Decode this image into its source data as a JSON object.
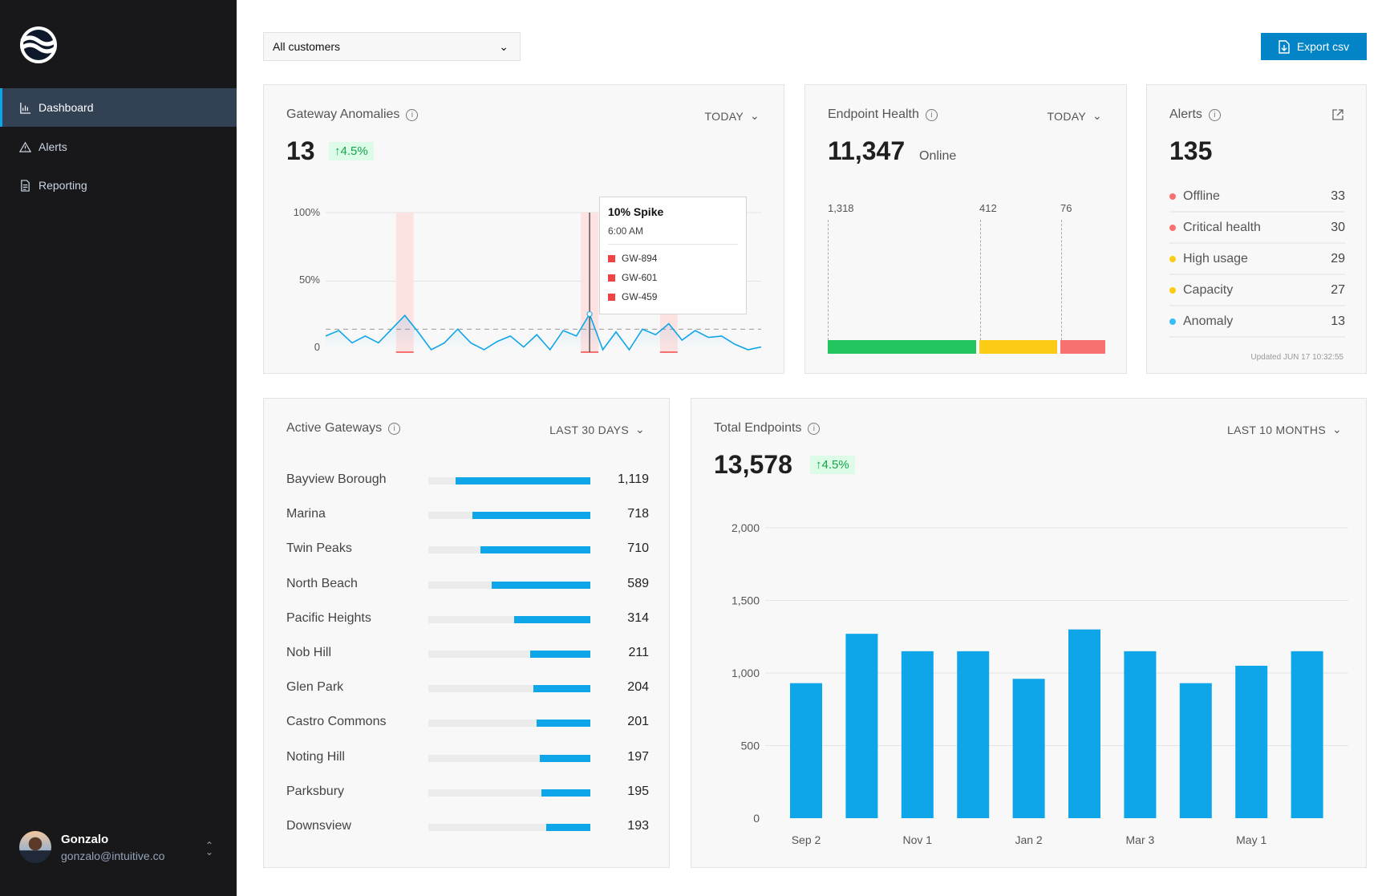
{
  "sidebar": {
    "items": [
      {
        "label": "Dashboard",
        "icon": "bar-chart-icon",
        "active": true
      },
      {
        "label": "Alerts",
        "icon": "warning-icon"
      },
      {
        "label": "Reporting",
        "icon": "document-icon"
      }
    ],
    "user": {
      "name": "Gonzalo",
      "email": "gonzalo@intuitive.co"
    }
  },
  "toolbar": {
    "customer_select": "All customers",
    "export_label": "Export csv"
  },
  "gateway_anomalies": {
    "title": "Gateway Anomalies",
    "range": "TODAY",
    "value": "13",
    "delta": "4.5%",
    "y_ticks": [
      "100%",
      "50%",
      "0"
    ],
    "series_pct": [
      10,
      14,
      5,
      10,
      5,
      15,
      25,
      13,
      0,
      5,
      15,
      5,
      0,
      6,
      10,
      2,
      11,
      0,
      14,
      10,
      26,
      0,
      13,
      0,
      15,
      11,
      19,
      7,
      14,
      9,
      10,
      4,
      0,
      2
    ],
    "threshold_pct": 15,
    "anomaly_indices": [
      6,
      20,
      26
    ],
    "tooltip": {
      "title": "10% Spike",
      "time": "6:00 AM",
      "items": [
        "GW-894",
        "GW-601",
        "GW-459"
      ]
    }
  },
  "endpoint_health": {
    "title": "Endpoint Health",
    "range": "TODAY",
    "value": "11,347",
    "value_label": "Online",
    "segments": [
      {
        "label": "1,318",
        "color": "#22c55e"
      },
      {
        "label": "412",
        "color": "#facc15"
      },
      {
        "label": "76",
        "color": "#f87171"
      }
    ]
  },
  "alerts": {
    "title": "Alerts",
    "value": "135",
    "updated": "Updated JUN 17 10:32:55",
    "items": [
      {
        "label": "Offline",
        "count": "33",
        "color": "#f87171"
      },
      {
        "label": "Critical health",
        "count": "30",
        "color": "#f87171"
      },
      {
        "label": "High usage",
        "count": "29",
        "color": "#facc15"
      },
      {
        "label": "Capacity",
        "count": "27",
        "color": "#facc15"
      },
      {
        "label": "Anomaly",
        "count": "13",
        "color": "#38bdf8"
      }
    ]
  },
  "active_gateways": {
    "title": "Active Gateways",
    "range": "LAST 30 DAYS",
    "rows": [
      {
        "name": "Bayview Borough",
        "value": "1,119",
        "fill": 0.83
      },
      {
        "name": "Marina",
        "value": "718",
        "fill": 0.73
      },
      {
        "name": "Twin Peaks",
        "value": "710",
        "fill": 0.68
      },
      {
        "name": "North Beach",
        "value": "589",
        "fill": 0.61
      },
      {
        "name": "Pacific Heights",
        "value": "314",
        "fill": 0.47
      },
      {
        "name": "Nob Hill",
        "value": "211",
        "fill": 0.37
      },
      {
        "name": "Glen Park",
        "value": "204",
        "fill": 0.35
      },
      {
        "name": "Castro Commons",
        "value": "201",
        "fill": 0.33
      },
      {
        "name": "Noting Hill",
        "value": "197",
        "fill": 0.31
      },
      {
        "name": "Parksbury",
        "value": "195",
        "fill": 0.3
      },
      {
        "name": "Downsview",
        "value": "193",
        "fill": 0.27
      }
    ]
  },
  "total_endpoints": {
    "title": "Total Endpoints",
    "range": "LAST 10 MONTHS",
    "value": "13,578",
    "delta": "4.5%"
  },
  "chart_data": {
    "type": "bar",
    "title": "",
    "xlabel": "",
    "ylabel": "",
    "ylim": [
      0,
      2000
    ],
    "grid": true,
    "y_ticks": [
      "2,000",
      "1,500",
      "1,000",
      "500",
      "0"
    ],
    "x_tick_labels": [
      "Sep 2",
      "",
      "Nov 1",
      "",
      "Jan 2",
      "",
      "Mar 3",
      "",
      "May 1",
      ""
    ],
    "values": [
      930,
      1270,
      1150,
      1150,
      960,
      1300,
      1150,
      930,
      1050,
      1150
    ],
    "color": "#0ea5e9"
  }
}
